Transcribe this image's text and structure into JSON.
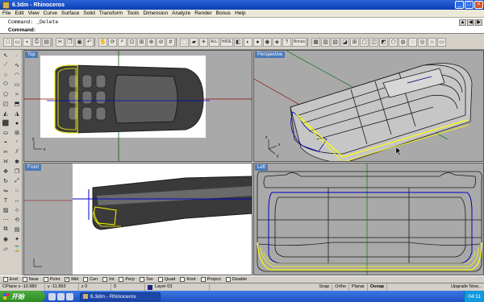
{
  "window": {
    "title": "6.3dm - Rhinoceros",
    "buttons": {
      "minimize": "_",
      "maximize": "□",
      "close": "×"
    }
  },
  "menu": [
    "File",
    "Edit",
    "View",
    "Curve",
    "Surface",
    "Solid",
    "Transform",
    "Tools",
    "Dimension",
    "Analyze",
    "Render",
    "Bonus",
    "Help"
  ],
  "command": {
    "history": "Command: _Delete",
    "prompt_label": "Command:",
    "prompt_value": ""
  },
  "toolbar": {
    "text_buttons": [
      "ALL",
      "HIDE",
      "Bonus"
    ]
  },
  "viewports": {
    "top": {
      "label": "Top"
    },
    "perspective": {
      "label": "Perspective"
    },
    "front": {
      "label": "Front"
    },
    "left": {
      "label": "Left"
    }
  },
  "axes": {
    "x": "x",
    "y": "y",
    "z": "z"
  },
  "osnap": [
    {
      "label": "End",
      "checked": false
    },
    {
      "label": "Near",
      "checked": false
    },
    {
      "label": "Point",
      "checked": false
    },
    {
      "label": "Mid",
      "checked": true
    },
    {
      "label": "Cen",
      "checked": false
    },
    {
      "label": "Int",
      "checked": false
    },
    {
      "label": "Perp",
      "checked": false
    },
    {
      "label": "Tan",
      "checked": false
    },
    {
      "label": "Quad",
      "checked": false
    },
    {
      "label": "Knot",
      "checked": false
    },
    {
      "label": "Project",
      "checked": false
    },
    {
      "label": "Disable",
      "checked": false
    }
  ],
  "status": {
    "cplane": "CPlane x -10.980",
    "y": "y -11.893",
    "z": "z 0",
    "extra": "0",
    "layer": "Layer 03",
    "snap": "Snap",
    "ortho": "Ortho",
    "planar": "Planar",
    "osnap": "Osnap",
    "message": "Upgrade Now..."
  },
  "taskbar": {
    "start": "开始",
    "task": "6.3dm - Rhinoceros",
    "clock": "04:11"
  },
  "colors": {
    "viewport_bg": "#a9a9a9",
    "active_label": "#4a79b8",
    "selection_yellow": "#ffff00",
    "curve_blue": "#0000c8"
  }
}
